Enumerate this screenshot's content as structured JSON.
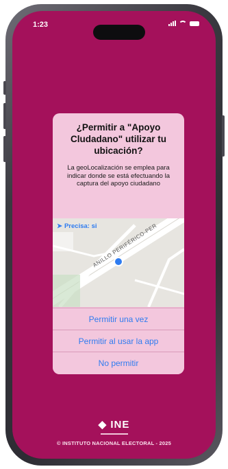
{
  "status_bar": {
    "time": "1:23"
  },
  "dialog": {
    "title": "¿Permitir a \"Apoyo Cludadano\" utilizar tu ubicación?",
    "message": "La geoLocalización se emplea para indicar donde se está efectuando la captura del apoyo ciudadano",
    "map": {
      "precise_label": "Precisa: si",
      "road_label": "ANILLO PERIFÉRICO-PER"
    },
    "buttons": {
      "allow_once": "Permitir una vez",
      "allow_while_using": "Permitir al usar la app",
      "deny": "No permitir"
    }
  },
  "footer": {
    "logo": "INE",
    "copyright": "© INSTITUTO NACIONAL ELECTORAL - 2025"
  },
  "colors": {
    "background": "#a4115b",
    "dialog_background": "#f3c7dd",
    "link_blue": "#2f7cf0"
  }
}
